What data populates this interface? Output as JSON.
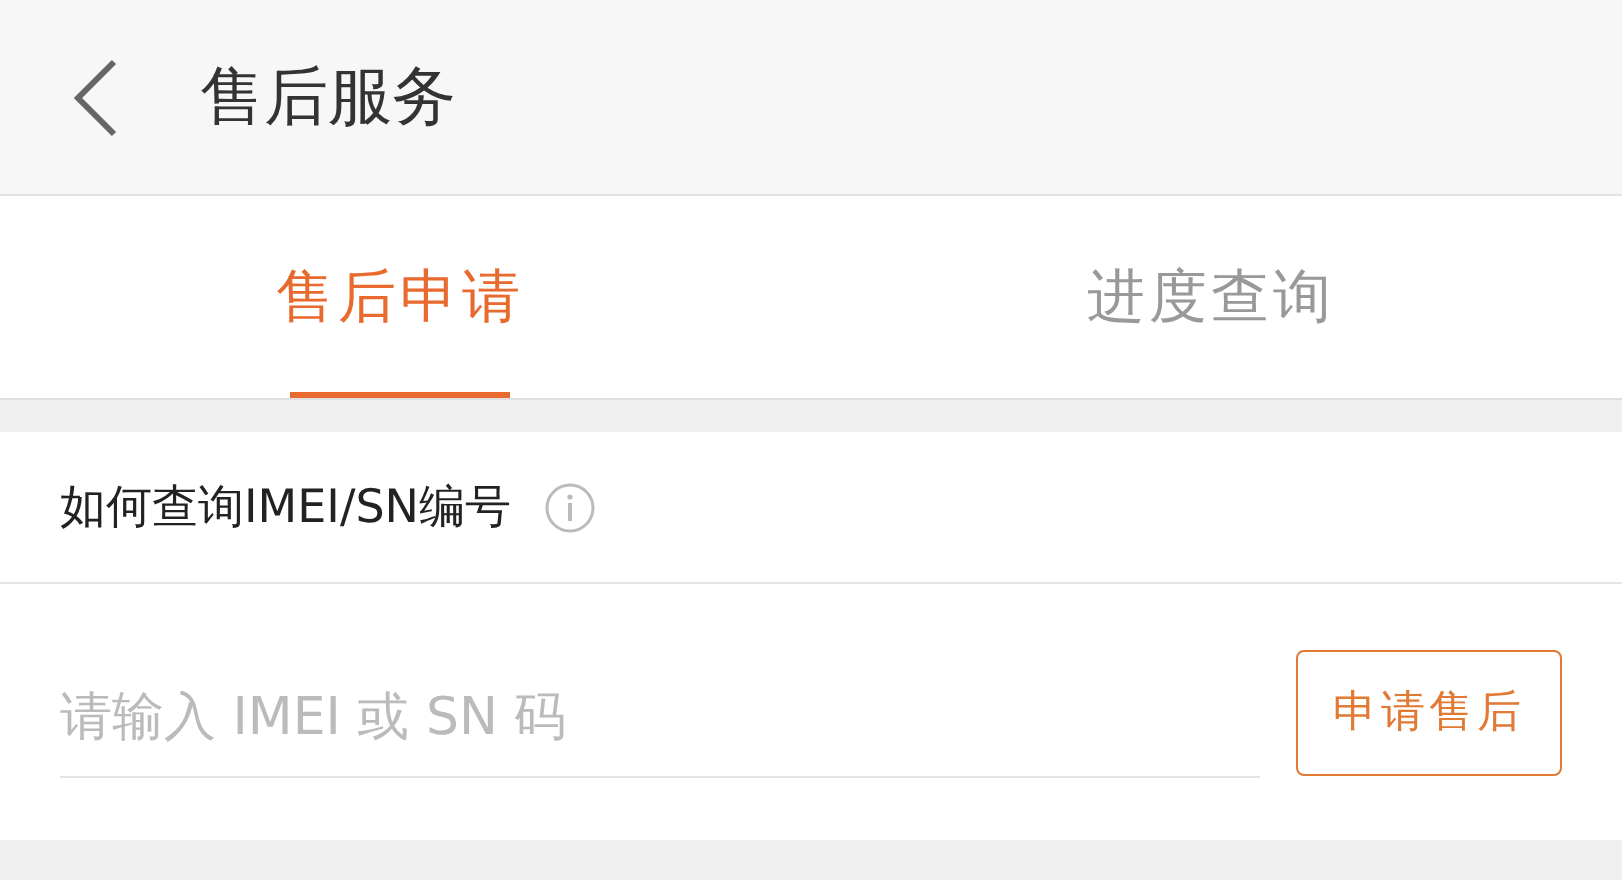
{
  "header": {
    "title": "售后服务"
  },
  "tabs": [
    {
      "label": "售后申请",
      "selected": true
    },
    {
      "label": "进度查询",
      "selected": false
    }
  ],
  "help": {
    "label": "如何查询IMEI/SN编号"
  },
  "form": {
    "placeholder": "请输入 IMEI 或 SN 码",
    "button": "申请售后"
  }
}
